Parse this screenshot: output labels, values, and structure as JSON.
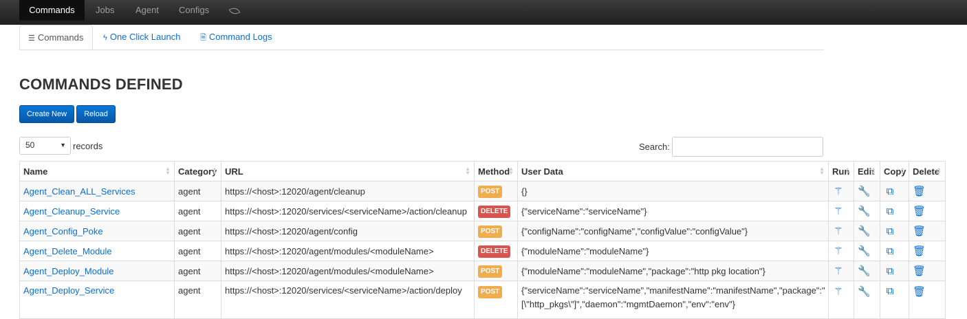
{
  "nav": {
    "items": [
      "Commands",
      "Jobs",
      "Agent",
      "Configs"
    ],
    "leaf_icon": "leaf-icon"
  },
  "tabs": [
    {
      "label": "Commands",
      "icon": "list-icon"
    },
    {
      "label": "One Click Launch",
      "icon": "bolt-icon"
    },
    {
      "label": "Command Logs",
      "icon": "file-icon"
    }
  ],
  "page": {
    "title": "COMMANDS DEFINED",
    "create_label": "Create New",
    "reload_label": "Reload",
    "page_size": "50",
    "records_label": "records",
    "search_label": "Search:",
    "search_value": ""
  },
  "table": {
    "headers": [
      "Name",
      "Category",
      "URL",
      "Method",
      "User Data",
      "Run",
      "Edit",
      "Copy",
      "Delete"
    ],
    "rows": [
      {
        "name": "Agent_Clean_ALL_Services",
        "category": "agent",
        "url": "https://<host>:12020/agent/cleanup",
        "method": "POST",
        "user_data": "{}"
      },
      {
        "name": "Agent_Cleanup_Service",
        "category": "agent",
        "url": "https://<host>:12020/services/<serviceName>/action/cleanup",
        "method": "DELETE",
        "user_data": "{\"serviceName\":\"serviceName\"}"
      },
      {
        "name": "Agent_Config_Poke",
        "category": "agent",
        "url": "https://<host>:12020/agent/config",
        "method": "POST",
        "user_data": "{\"configName\":\"configName\",\"configValue\":\"configValue\"}"
      },
      {
        "name": "Agent_Delete_Module",
        "category": "agent",
        "url": "https://<host>:12020/agent/modules/<moduleName>",
        "method": "DELETE",
        "user_data": "{\"moduleName\":\"moduleName\"}"
      },
      {
        "name": "Agent_Deploy_Module",
        "category": "agent",
        "url": "https://<host>:12020/agent/modules/<moduleName>",
        "method": "POST",
        "user_data": "{\"moduleName\":\"moduleName\",\"package\":\"http pkg location\"}"
      },
      {
        "name": "Agent_Deploy_Service",
        "category": "agent",
        "url": "https://<host>:12020/services/<serviceName>/action/deploy",
        "method": "POST",
        "user_data": "{\"serviceName\":\"serviceName\",\"manifestName\":\"manifestName\",\"package\":\"[\\\"http_pkgs\\\"]\",\"daemon\":\"mgmtDaemon\",\"env\":\"env\"}"
      }
    ],
    "action_icons": [
      "wand-icon",
      "wrench-icon",
      "copy-icon",
      "trash-icon"
    ]
  },
  "colors": {
    "post": "#f0ad4e",
    "delete": "#d9534f",
    "link": "#0a6dd3",
    "primary": "#0a6dd3"
  }
}
